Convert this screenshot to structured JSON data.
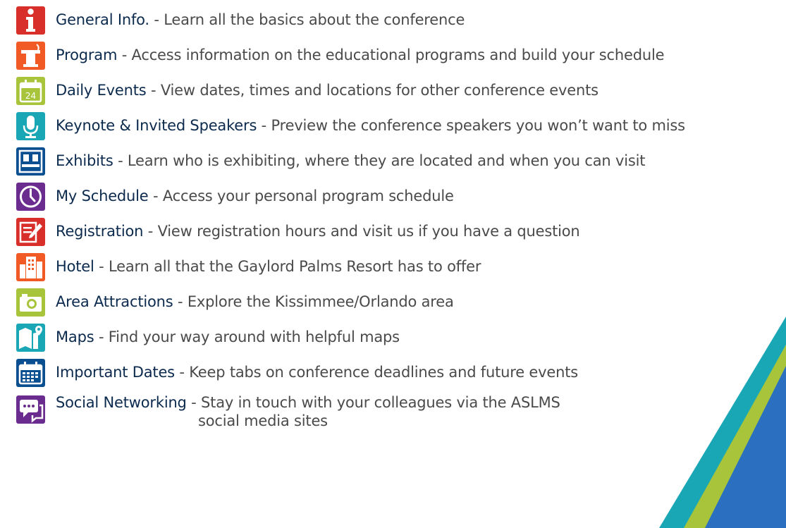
{
  "items": [
    {
      "id": "general-info",
      "title": "General Info.",
      "desc": " - Learn all the basics about the conference",
      "icon": "info-icon",
      "color": "#d92f2a"
    },
    {
      "id": "program",
      "title": "Program",
      "desc": " - Access information on the educational programs and build your schedule",
      "icon": "podium-icon",
      "color": "#f15a24"
    },
    {
      "id": "daily-events",
      "title": "Daily Events",
      "desc": " - View dates, times and locations for other conference events",
      "icon": "calendar-icon",
      "color": "#a7c43a"
    },
    {
      "id": "keynote",
      "title": "Keynote & Invited Speakers",
      "desc": " - Preview the conference speakers you won’t want to miss",
      "icon": "microphone-icon",
      "color": "#1aa7b5"
    },
    {
      "id": "exhibits",
      "title": "Exhibits",
      "desc": " - Learn who is exhibiting, where they are located and when you can visit",
      "icon": "exhibit-booth-icon",
      "color": "#0a4f8f"
    },
    {
      "id": "my-schedule",
      "title": "My Schedule",
      "desc": " - Access your personal program schedule",
      "icon": "clock-icon",
      "color": "#6a2c8f"
    },
    {
      "id": "registration",
      "title": "Registration",
      "desc": " - View registration hours and visit us if you have a question",
      "icon": "edit-form-icon",
      "color": "#d92f2a"
    },
    {
      "id": "hotel",
      "title": "Hotel",
      "desc": " - Learn all that the Gaylord Palms Resort has to offer",
      "icon": "building-icon",
      "color": "#f15a24"
    },
    {
      "id": "area-attractions",
      "title": "Area Attractions",
      "desc": " - Explore the Kissimmee/Orlando area",
      "icon": "camera-icon",
      "color": "#a7c43a"
    },
    {
      "id": "maps",
      "title": "Maps",
      "desc": " - Find your way around with helpful maps",
      "icon": "map-icon",
      "color": "#1aa7b5"
    },
    {
      "id": "important-dates",
      "title": "Important Dates",
      "desc": " - Keep tabs on conference deadlines and future events",
      "icon": "calendar-grid-icon",
      "color": "#0a4f8f"
    },
    {
      "id": "social",
      "title": "Social Networking",
      "desc": " - Stay in touch with your colleagues via the ASLMS",
      "desc2": "social media sites",
      "icon": "chat-bubble-icon",
      "color": "#6a2c8f"
    }
  ],
  "calendar_day": "24"
}
